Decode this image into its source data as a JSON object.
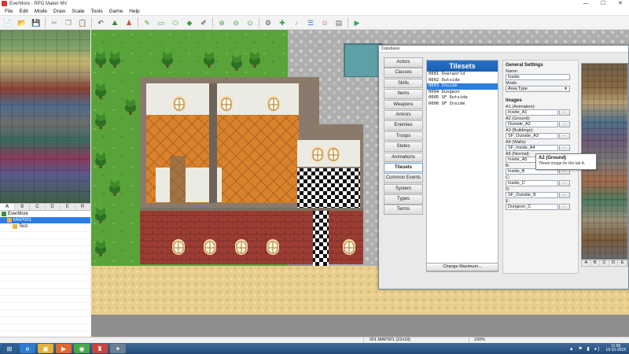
{
  "window": {
    "title": "EverMore - RPG Maker MV",
    "controls": [
      "—",
      "☐",
      "✕"
    ]
  },
  "menu": [
    "File",
    "Edit",
    "Mode",
    "Draw",
    "Scale",
    "Tools",
    "Game",
    "Help"
  ],
  "toolbar": [
    {
      "name": "new-project-icon",
      "glyph": "📄"
    },
    {
      "name": "open-project-icon",
      "glyph": "📂"
    },
    {
      "name": "save-project-icon",
      "glyph": "💾"
    },
    {
      "name": "cut-icon",
      "glyph": "✂"
    },
    {
      "name": "copy-icon",
      "glyph": "❐"
    },
    {
      "name": "paste-icon",
      "glyph": "📋"
    },
    {
      "name": "undo-icon",
      "glyph": "↶"
    },
    {
      "name": "map-mode-icon",
      "glyph": "⛰"
    },
    {
      "name": "event-mode-icon",
      "glyph": "♟"
    },
    {
      "name": "pencil-icon",
      "glyph": "✎"
    },
    {
      "name": "rectangle-icon",
      "glyph": "▭"
    },
    {
      "name": "ellipse-icon",
      "glyph": "⬭"
    },
    {
      "name": "flood-fill-icon",
      "glyph": "◆"
    },
    {
      "name": "shadow-pen-icon",
      "glyph": "✐"
    },
    {
      "name": "zoom-in-icon",
      "glyph": "⊕"
    },
    {
      "name": "zoom-out-icon",
      "glyph": "⊖"
    },
    {
      "name": "actual-size-icon",
      "glyph": "⊙"
    },
    {
      "name": "database-icon",
      "glyph": "⚙"
    },
    {
      "name": "plugin-manager-icon",
      "glyph": "✚"
    },
    {
      "name": "sound-test-icon",
      "glyph": "♪"
    },
    {
      "name": "event-searcher-icon",
      "glyph": "☰"
    },
    {
      "name": "character-generator-icon",
      "glyph": "☺"
    },
    {
      "name": "resource-manager-icon",
      "glyph": "▤"
    },
    {
      "name": "playtest-icon",
      "glyph": "▶"
    }
  ],
  "palette_tabs": [
    "A",
    "B",
    "C",
    "D",
    "E",
    "R"
  ],
  "map_tree": [
    {
      "label": "EverMore",
      "level": 0,
      "selected": false
    },
    {
      "label": "MAP001",
      "level": 1,
      "selected": true
    },
    {
      "label": "Test",
      "level": 2,
      "selected": false
    }
  ],
  "database": {
    "title": "Database",
    "categories": [
      "Actors",
      "Classes",
      "Skills",
      "Items",
      "Weapons",
      "Armors",
      "Enemies",
      "Troops",
      "States",
      "Animations",
      "Tilesets",
      "Common Events",
      "System",
      "Types",
      "Terms"
    ],
    "active_category": "Tilesets",
    "tilesets_header": "Tilesets",
    "tilesets": [
      "0001 Overworld",
      "0002 Outside",
      "0003 Inside",
      "0004 Dungeon",
      "0005 SF Outside",
      "0006 SF Inside"
    ],
    "selected_tileset": "0003 Inside",
    "change_max_label": "Change Maximum...",
    "general": {
      "heading": "General Settings",
      "name_label": "Name:",
      "name_value": "Inside",
      "mode_label": "Mode:",
      "mode_value": "Area Type"
    },
    "images": {
      "heading": "Images",
      "slots": [
        {
          "label": "A1 (Animation):",
          "value": "Inside_A1"
        },
        {
          "label": "A2 (Ground):",
          "value": "Outside_A2"
        },
        {
          "label": "A3 (Buildings):",
          "value": "SF_Outside_A3"
        },
        {
          "label": "A4 (Walls):",
          "value": "SF_Inside_A4"
        },
        {
          "label": "A5 (Normal):",
          "value": "Inside_A5"
        },
        {
          "label": "B:",
          "value": "Inside_B"
        },
        {
          "label": "C:",
          "value": "Inside_C"
        },
        {
          "label": "D:",
          "value": "SF_Outside_B"
        },
        {
          "label": "E:",
          "value": "Dungeon_C"
        }
      ],
      "browse_label": "..."
    },
    "preview_tabs": [
      "A",
      "B",
      "C",
      "D",
      "E"
    ],
    "tooltip": {
      "title": "A2 (Ground)",
      "body": "Tileset image for the tab A."
    }
  },
  "statusbar": {
    "map_info": "001:MAP001 (22x18)",
    "zoom": "100%"
  },
  "taskbar": {
    "apps": [
      {
        "name": "start-button",
        "glyph": "⊞",
        "color": "#2a5d91"
      },
      {
        "name": "internet-explorer-icon",
        "glyph": "e",
        "color": "#2d7dd2"
      },
      {
        "name": "file-explorer-icon",
        "glyph": "▣",
        "color": "#e2b33c"
      },
      {
        "name": "media-player-icon",
        "glyph": "▶",
        "color": "#e06a2b"
      },
      {
        "name": "chrome-icon",
        "glyph": "◉",
        "color": "#4aa84b"
      },
      {
        "name": "rpg-maker-icon",
        "glyph": "♜",
        "color": "#c7453d"
      },
      {
        "name": "app-icon",
        "glyph": "✦",
        "color": "#6a7f94"
      }
    ],
    "tray_icons": "▲ ⚑ ▮ ◂)",
    "time": "11:56",
    "date": "18-10-2018"
  }
}
